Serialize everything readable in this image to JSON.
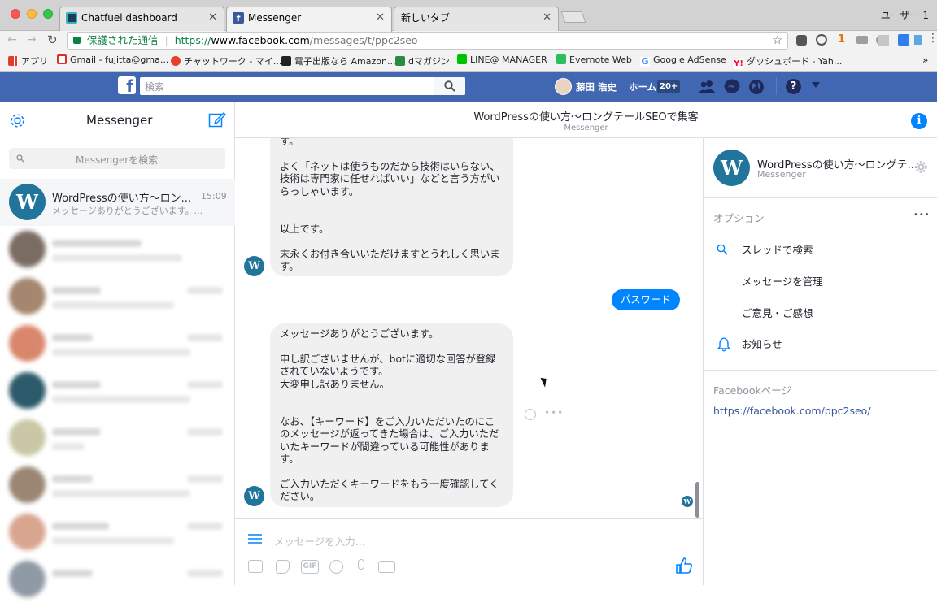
{
  "browser": {
    "tabs": [
      {
        "title": "Chatfuel dashboard",
        "active": false
      },
      {
        "title": "Messenger",
        "active": true
      },
      {
        "title": "新しいタブ",
        "active": false
      }
    ],
    "user_label": "ユーザー 1",
    "address": {
      "secure_label": "保護された通信",
      "url_scheme": "https://",
      "url_host": "www.facebook.com",
      "url_path": "/messages/t/ppc2seo"
    },
    "bookmarks": [
      {
        "label": "アプリ",
        "icon": "apps-grid-icon",
        "color": "#e03c31"
      },
      {
        "label": "Gmail - fujitta@gma...",
        "icon": "gmail-icon",
        "color": "#d93025"
      },
      {
        "label": "チャットワーク - マイ...",
        "icon": "chatwork-icon",
        "color": "#e8412b"
      },
      {
        "label": "電子出版なら Amazon...",
        "icon": "amazon-icon",
        "color": "#222222"
      },
      {
        "label": "dマガジン",
        "icon": "dmagazine-icon",
        "color": "#2b8a3e"
      },
      {
        "label": "LINE@ MANAGER",
        "icon": "line-icon",
        "color": "#00c300"
      },
      {
        "label": "Evernote Web",
        "icon": "evernote-icon",
        "color": "#2dbe60"
      },
      {
        "label": "Google AdSense",
        "icon": "google-icon",
        "color": "#4285f4"
      },
      {
        "label": "ダッシュボード - Yah...",
        "icon": "yahoo-icon",
        "color": "#ff0033"
      }
    ],
    "bookmarks_overflow": "»"
  },
  "fb_header": {
    "search_placeholder": "検索",
    "user_name": "藤田 浩史",
    "home_label": "ホーム",
    "home_badge": "20+"
  },
  "messenger_sidebar": {
    "title": "Messenger",
    "search_placeholder": "Messengerを検索",
    "active_conversation": {
      "name": "WordPressの使い方〜ロン...",
      "time": "15:09",
      "snippet": "メッセージありがとうございます。...",
      "avatar_text": "W"
    }
  },
  "conversation": {
    "title": "WordPressの使い方〜ロングテールSEOで集客",
    "subtitle": "Messenger",
    "bubble_top_text": "す。\n\nよく「ネットは使うものだから技術はいらない、\n技術は専門家に任せればいい」などと言う方がい\nらっしゃいます。\n\n\n以上です。\n\n末永くお付き合いいただけますとうれしく思いま\nす。",
    "outgoing_text": "パスワード",
    "bubble_bottom_text": "メッセージありがとうございます。\n\n申し訳ございませんが、botに適切な回答が登録\nされていないようです。\n大変申し訳ありません。\n\n\nなお、【キーワード】をご入力いただいたのにこ\nのメッセージが返ってきた場合は、ご入力いただ\nいたキーワードが間違っている可能性がありま\nす。\n\nご入力いただくキーワードをもう一度確認してく\nださい。",
    "composer_placeholder": "メッセージを入力...",
    "gif_label": "GIF",
    "accent_color": "#0084ff"
  },
  "info_panel": {
    "name": "WordPressの使い方〜ロングテ...",
    "subtitle": "Messenger",
    "options_label": "オプション",
    "options_more": "•••",
    "options": [
      {
        "label": "スレッドで検索",
        "icon": "search-icon"
      },
      {
        "label": "メッセージを管理",
        "icon": ""
      },
      {
        "label": "ご意見・ご感想",
        "icon": ""
      },
      {
        "label": "お知らせ",
        "icon": "bell-icon"
      }
    ],
    "fb_page_label": "Facebookページ",
    "fb_page_link": "https://facebook.com/ppc2seo/"
  }
}
